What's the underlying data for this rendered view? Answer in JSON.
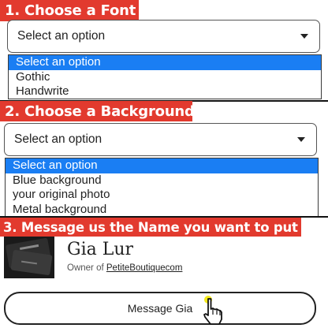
{
  "step1": {
    "banner": "1. Choose a Font",
    "select_value": "Select an option",
    "options": [
      "Select an option",
      "Gothic",
      "Handwrite"
    ],
    "selected_index": 0
  },
  "step2": {
    "banner": "2. Choose a Background",
    "select_value": "Select an option",
    "options": [
      "Select an option",
      "Blue background",
      "your original photo",
      "Metal background"
    ],
    "selected_index": 0
  },
  "step3": {
    "banner": "3. Message us the Name you want to put"
  },
  "seller": {
    "name": "Gia Lur",
    "owner_prefix": "Owner of",
    "shop": "PetiteBoutiquecom",
    "message_button": "Message Gia"
  },
  "colors": {
    "banner_bg": "#e23a2e",
    "option_highlight": "#1a7ef3"
  },
  "icons": {
    "select_arrow": "caret-down-icon",
    "cursor": "hand-pointer-icon"
  }
}
